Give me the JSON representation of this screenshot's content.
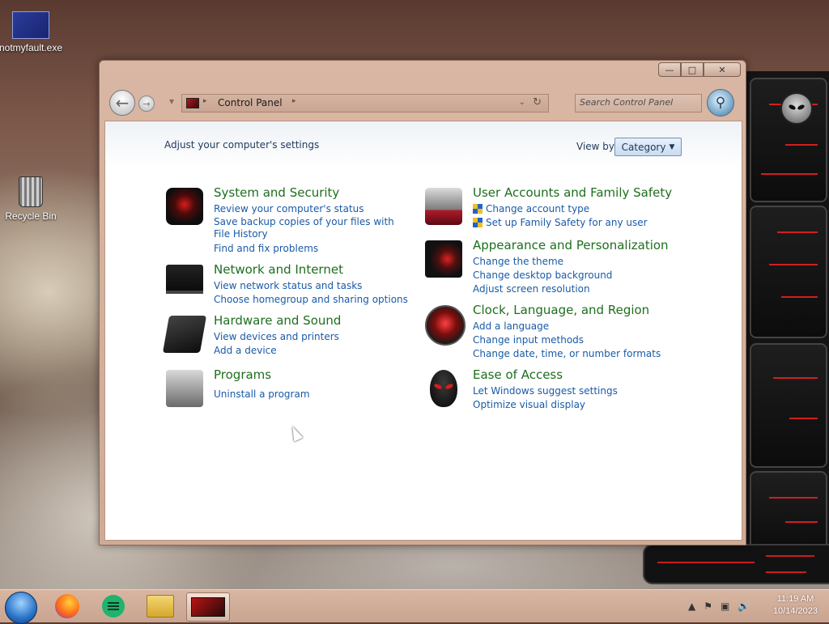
{
  "desktop": {
    "icons": [
      {
        "label": "notmyfault.exe"
      },
      {
        "label": "Recycle Bin"
      }
    ]
  },
  "window": {
    "controls": {
      "minimize": "—",
      "maximize": "□",
      "close": "✕"
    },
    "nav": {
      "back": "←",
      "forward": "→"
    },
    "address": {
      "crumb": "Control Panel",
      "separator": "▸"
    },
    "search": {
      "placeholder": "Search Control Panel",
      "value": ""
    }
  },
  "content": {
    "heading": "Adjust your computer's settings",
    "view_by": {
      "label": "View by:",
      "selected": "Category"
    },
    "categories_left": [
      {
        "title": "System and Security",
        "icon": "system-security-icon",
        "links": [
          "Review your computer's status",
          "Save backup copies of your files with File History",
          "Find and fix problems"
        ]
      },
      {
        "title": "Network and Internet",
        "icon": "network-icon",
        "links": [
          "View network status and tasks",
          "Choose homegroup and sharing options"
        ]
      },
      {
        "title": "Hardware and Sound",
        "icon": "hardware-icon",
        "links": [
          "View devices and printers",
          "Add a device"
        ]
      },
      {
        "title": "Programs",
        "icon": "programs-icon",
        "links": [
          "Uninstall a program"
        ]
      }
    ],
    "categories_right": [
      {
        "title": "User Accounts and Family Safety",
        "icon": "user-accounts-icon",
        "links": [
          "Change account type",
          "Set up Family Safety for any user"
        ]
      },
      {
        "title": "Appearance and Personalization",
        "icon": "appearance-icon",
        "links": [
          "Change the theme",
          "Change desktop background",
          "Adjust screen resolution"
        ]
      },
      {
        "title": "Clock, Language, and Region",
        "icon": "clock-region-icon",
        "links": [
          "Add a language",
          "Change input methods",
          "Change date, time, or number formats"
        ]
      },
      {
        "title": "Ease of Access",
        "icon": "ease-of-access-icon",
        "links": [
          "Let Windows suggest settings",
          "Optimize visual display"
        ]
      }
    ]
  },
  "taskbar": {
    "apps": [
      "start-orb",
      "firefox-icon",
      "spreadsheet-icon",
      "file-explorer-icon",
      "control-panel-icon"
    ],
    "clock": {
      "time": "11:19 AM",
      "date": "10/14/2023"
    }
  }
}
